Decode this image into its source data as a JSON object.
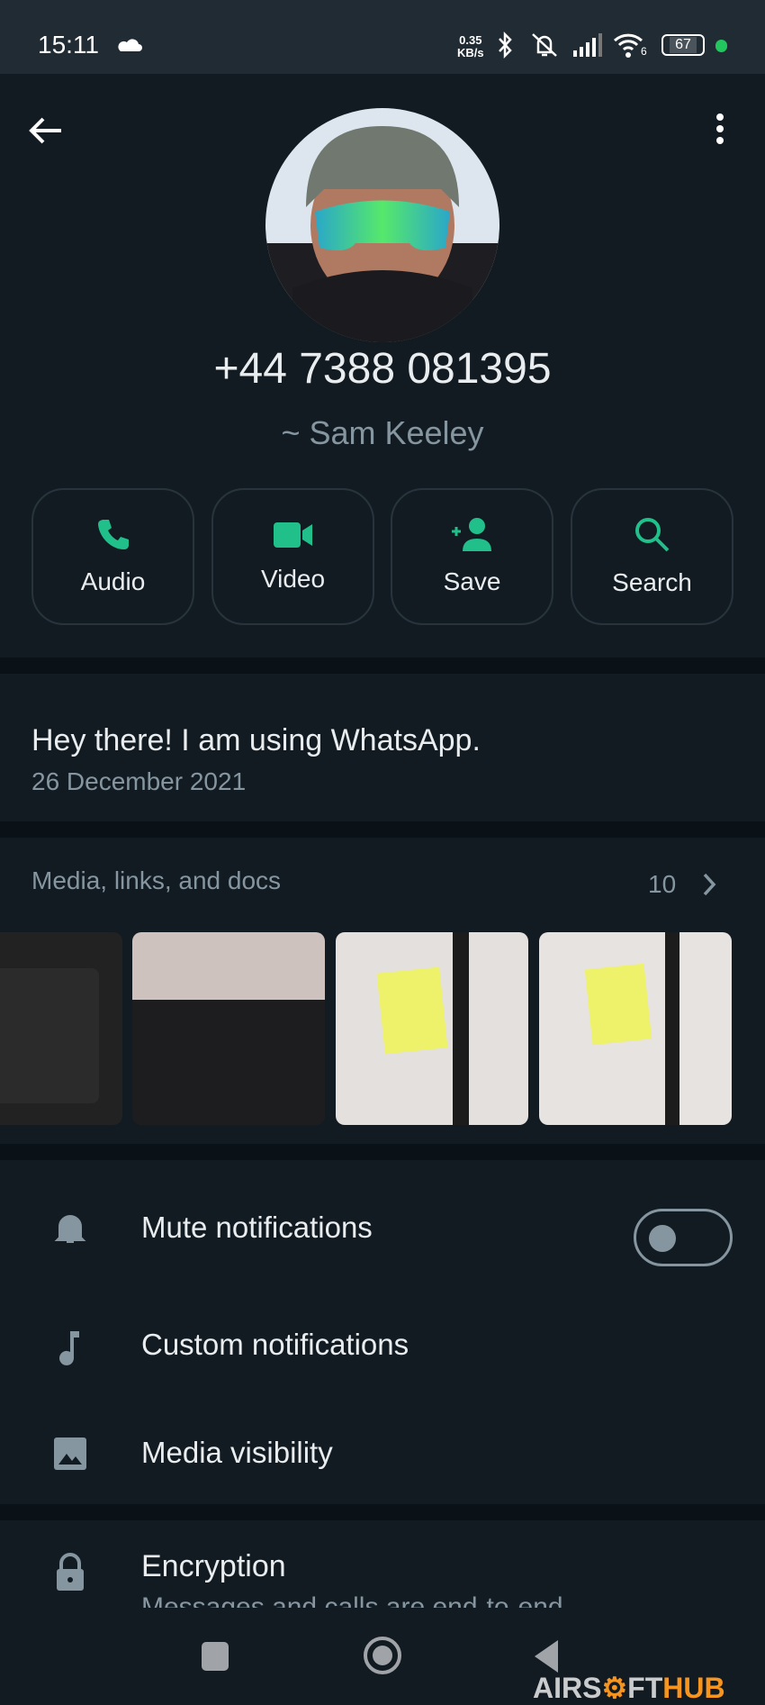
{
  "status_bar": {
    "time": "15:11",
    "net_speed_value": "0.35",
    "net_speed_unit": "KB/s",
    "battery": "67",
    "wifi_label": "6",
    "icons": [
      "cloud-icon",
      "bluetooth-icon",
      "mute-vibrate-icon",
      "signal-icon",
      "wifi-icon",
      "battery-icon"
    ]
  },
  "profile": {
    "phone": "+44 7388 081395",
    "name": "~ Sam Keeley"
  },
  "actions": [
    {
      "label": "Audio",
      "icon": "phone-icon"
    },
    {
      "label": "Video",
      "icon": "video-icon"
    },
    {
      "label": "Save",
      "icon": "add-contact-icon"
    },
    {
      "label": "Search",
      "icon": "search-icon"
    }
  ],
  "about": {
    "text": "Hey there! I am using WhatsApp.",
    "date": "26 December 2021"
  },
  "media": {
    "title": "Media, links, and docs",
    "count": "10"
  },
  "settings": [
    {
      "label": "Mute notifications",
      "icon": "bell-icon",
      "toggle": false
    },
    {
      "label": "Custom notifications",
      "icon": "music-note-icon"
    },
    {
      "label": "Media visibility",
      "icon": "image-icon"
    }
  ],
  "encryption": {
    "label": "Encryption",
    "sub": "Messages and calls are end-to-end"
  },
  "watermark": "AIRSOFTHUB",
  "colors": {
    "accent": "#21c08b",
    "bg": "#121b22",
    "band": "#0b1217"
  }
}
